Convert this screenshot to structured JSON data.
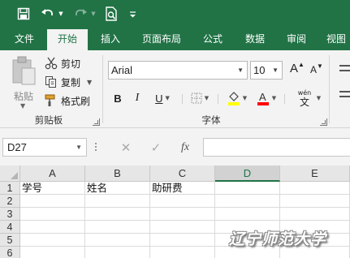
{
  "quick_access": {
    "save_icon": "save-icon",
    "undo_icon": "undo-icon",
    "redo_icon": "redo-icon",
    "print_preview_icon": "print-preview-icon",
    "customize_icon": "customize-quick-access-icon"
  },
  "tabs": [
    {
      "label": "文件",
      "active": false
    },
    {
      "label": "开始",
      "active": true
    },
    {
      "label": "插入",
      "active": false
    },
    {
      "label": "页面布局",
      "active": false
    },
    {
      "label": "公式",
      "active": false
    },
    {
      "label": "数据",
      "active": false
    },
    {
      "label": "审阅",
      "active": false
    },
    {
      "label": "视图",
      "active": false
    }
  ],
  "clipboard": {
    "paste_label": "粘贴",
    "cut_label": "剪切",
    "copy_label": "复制",
    "format_painter_label": "格式刷",
    "group_label": "剪贴板"
  },
  "font": {
    "font_name": "Arial",
    "font_size": "10",
    "bold": "B",
    "italic": "I",
    "underline": "U",
    "increase_size": "A",
    "decrease_size": "A",
    "wen_label": "wén",
    "wen_char": "文",
    "group_label": "字体",
    "highlight_color": "#ffff00",
    "font_color": "#ff0000"
  },
  "formula_bar": {
    "name_box": "D27",
    "fx_label": "fx",
    "formula": ""
  },
  "grid": {
    "columns": [
      "A",
      "B",
      "C",
      "D",
      "E"
    ],
    "selected_column": "D",
    "rows": [
      {
        "number": "1",
        "cells": [
          "学号",
          "姓名",
          "助研费",
          "",
          ""
        ]
      },
      {
        "number": "2",
        "cells": [
          "",
          "",
          "",
          "",
          ""
        ]
      },
      {
        "number": "3",
        "cells": [
          "",
          "",
          "",
          "",
          ""
        ]
      },
      {
        "number": "4",
        "cells": [
          "",
          "",
          "",
          "",
          ""
        ]
      },
      {
        "number": "5",
        "cells": [
          "",
          "",
          "",
          "",
          ""
        ]
      },
      {
        "number": "6",
        "cells": [
          "",
          "",
          "",
          "",
          ""
        ]
      }
    ]
  },
  "watermark": "辽宁师范大学",
  "colors": {
    "accent": "#217346",
    "ribbon_bg": "#f3f3f3",
    "header_bg": "#e6e6e6"
  }
}
